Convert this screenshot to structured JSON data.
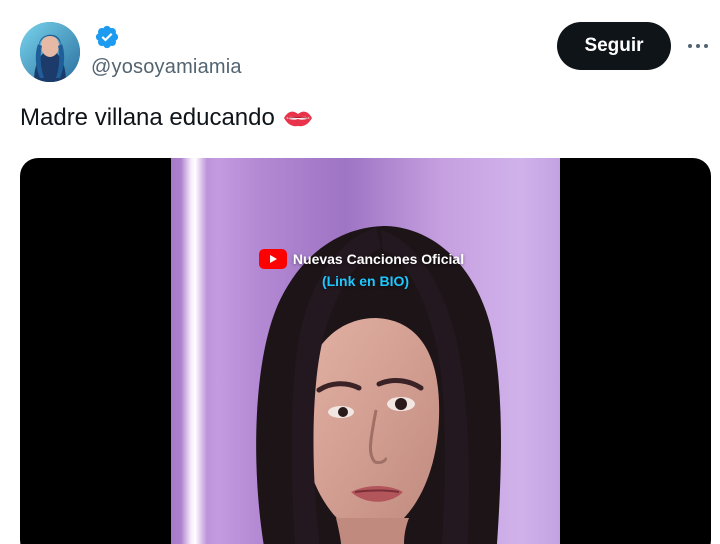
{
  "tweet": {
    "handle": "@yosoyamiamia",
    "follow_label": "Seguir",
    "text": "Madre villana educando",
    "text_emoji": "lips-icon"
  },
  "video": {
    "overlay_title": "Nuevas Canciones Oficial",
    "overlay_subtitle": "(Link en BIO)",
    "overlay_icon": "youtube-icon"
  },
  "colors": {
    "follow_bg": "#0f1419",
    "verified": "#1d9bf0",
    "handle": "#536471",
    "overlay_link": "#1ec8ff"
  }
}
